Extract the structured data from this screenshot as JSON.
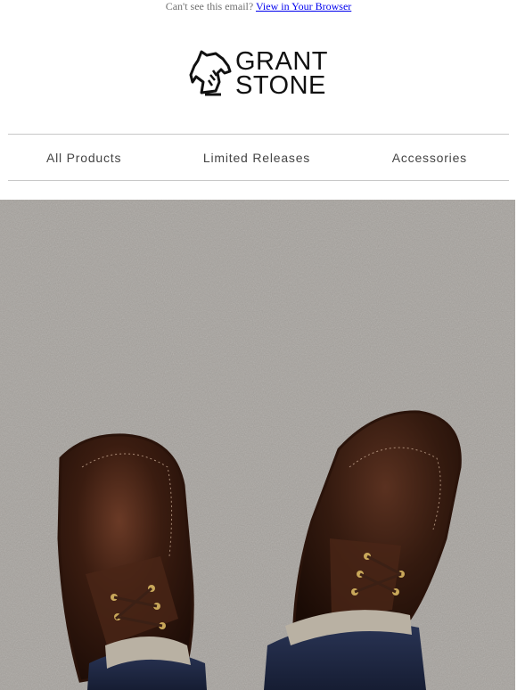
{
  "preheader": {
    "text": "Can't see this email?",
    "link": "View in Your Browser"
  },
  "brand": {
    "line1": "GRANT",
    "line2": "STONE"
  },
  "nav": {
    "items": [
      "All Products",
      "Limited Releases",
      "Accessories"
    ]
  },
  "hero": {
    "icon": "hero-photo-shoes-on-concrete",
    "colors": {
      "concrete": "#a7a39e",
      "leather": "#3a1c10",
      "denim": "#1f2a48"
    }
  }
}
